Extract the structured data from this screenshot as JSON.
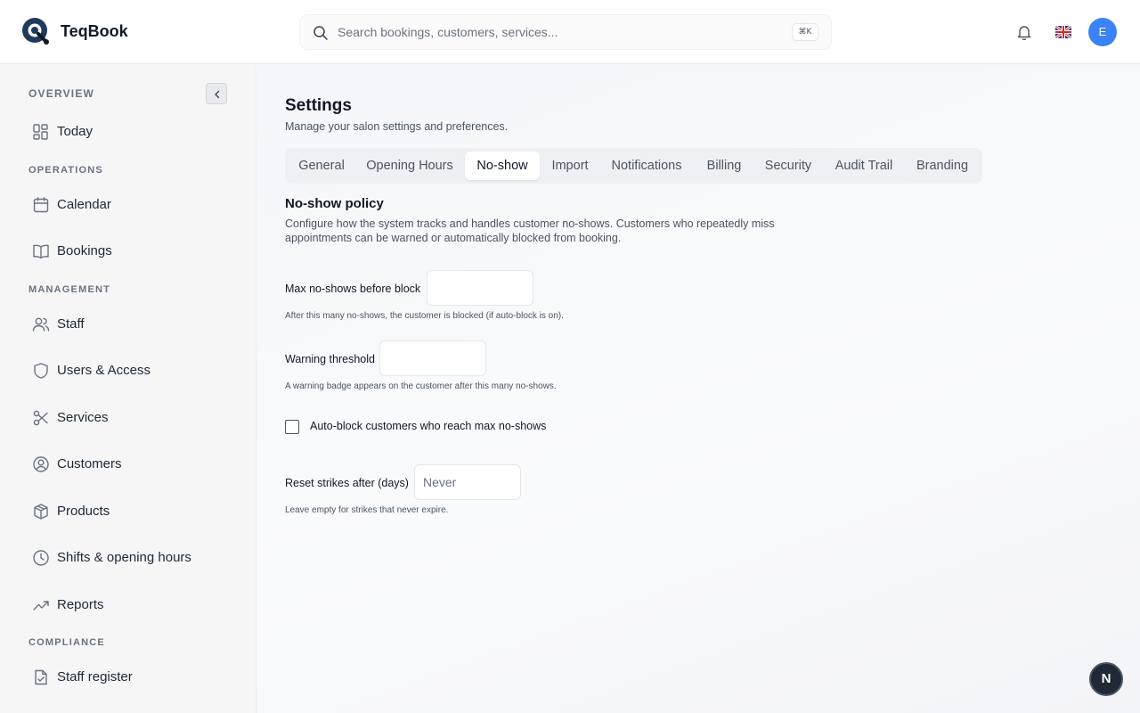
{
  "app": {
    "name": "TeqBook"
  },
  "search": {
    "placeholder": "Search bookings, customers, services...",
    "shortcut": "⌘K"
  },
  "header": {
    "avatar_initial": "E"
  },
  "sidebar": {
    "sections": {
      "overview": "OVERVIEW",
      "operations": "OPERATIONS",
      "management": "MANAGEMENT",
      "compliance": "COMPLIANCE"
    },
    "items": {
      "today": "Today",
      "calendar": "Calendar",
      "bookings": "Bookings",
      "staff": "Staff",
      "users": "Users & Access",
      "services": "Services",
      "customers": "Customers",
      "products": "Products",
      "shifts": "Shifts & opening hours",
      "reports": "Reports",
      "staff_register": "Staff register"
    }
  },
  "page": {
    "title": "Settings",
    "subtitle": "Manage your salon settings and preferences."
  },
  "tabs": [
    "General",
    "Opening Hours",
    "No-show",
    "Import",
    "Notifications",
    "Billing",
    "Security",
    "Audit Trail",
    "Branding"
  ],
  "active_tab": "No-show",
  "noshow": {
    "title": "No-show policy",
    "description": "Configure how the system tracks and handles customer no-shows. Customers who repeatedly miss appointments can be warned or automatically blocked from booking.",
    "max_label": "Max no-shows before block",
    "max_value": "",
    "max_help": "After this many no-shows, the customer is blocked (if auto-block is on).",
    "warning_label": "Warning threshold",
    "warning_value": "",
    "warning_help": "A warning badge appears on the customer after this many no-shows.",
    "autoblock_label": "Auto-block customers who reach max no-shows",
    "autoblock_checked": false,
    "reset_label": "Reset strikes after (days)",
    "reset_placeholder": "Never",
    "reset_help": "Leave empty for strikes that never expire."
  },
  "dev_badge": "N",
  "colors": {
    "accent": "#3b82f6",
    "avatar_bg": "#3b82f6"
  }
}
